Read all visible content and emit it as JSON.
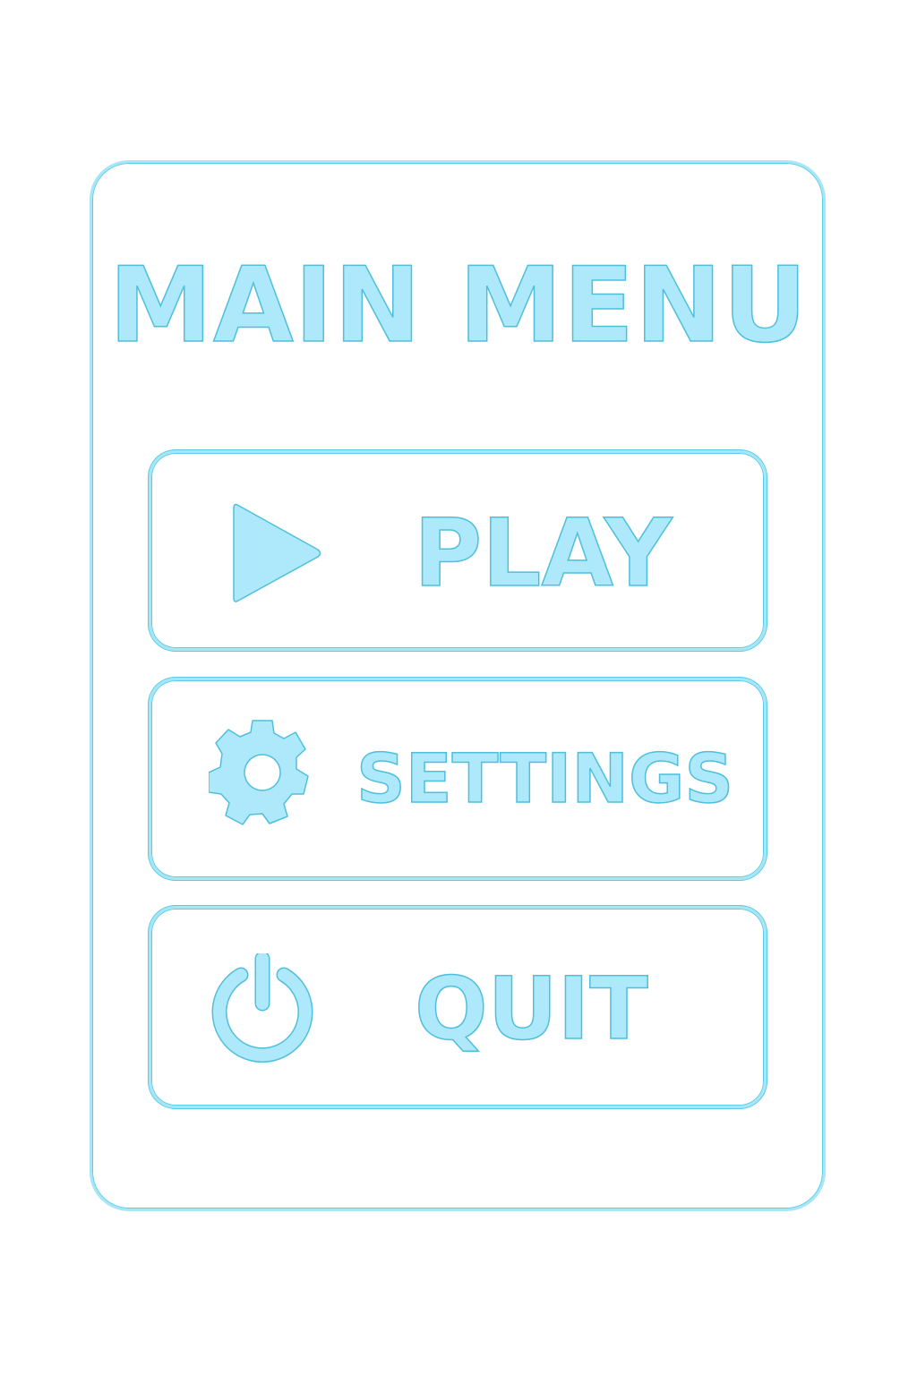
{
  "menu": {
    "title": "MAIN MENU",
    "buttons": [
      {
        "label": "PLAY",
        "icon": "play-icon"
      },
      {
        "label": "SETTINGS",
        "icon": "gear-icon"
      },
      {
        "label": "QUIT",
        "icon": "power-icon"
      }
    ]
  },
  "colors": {
    "fill": "#ade9fa",
    "outline": "#4fbfdc",
    "background": "#ffffff"
  }
}
